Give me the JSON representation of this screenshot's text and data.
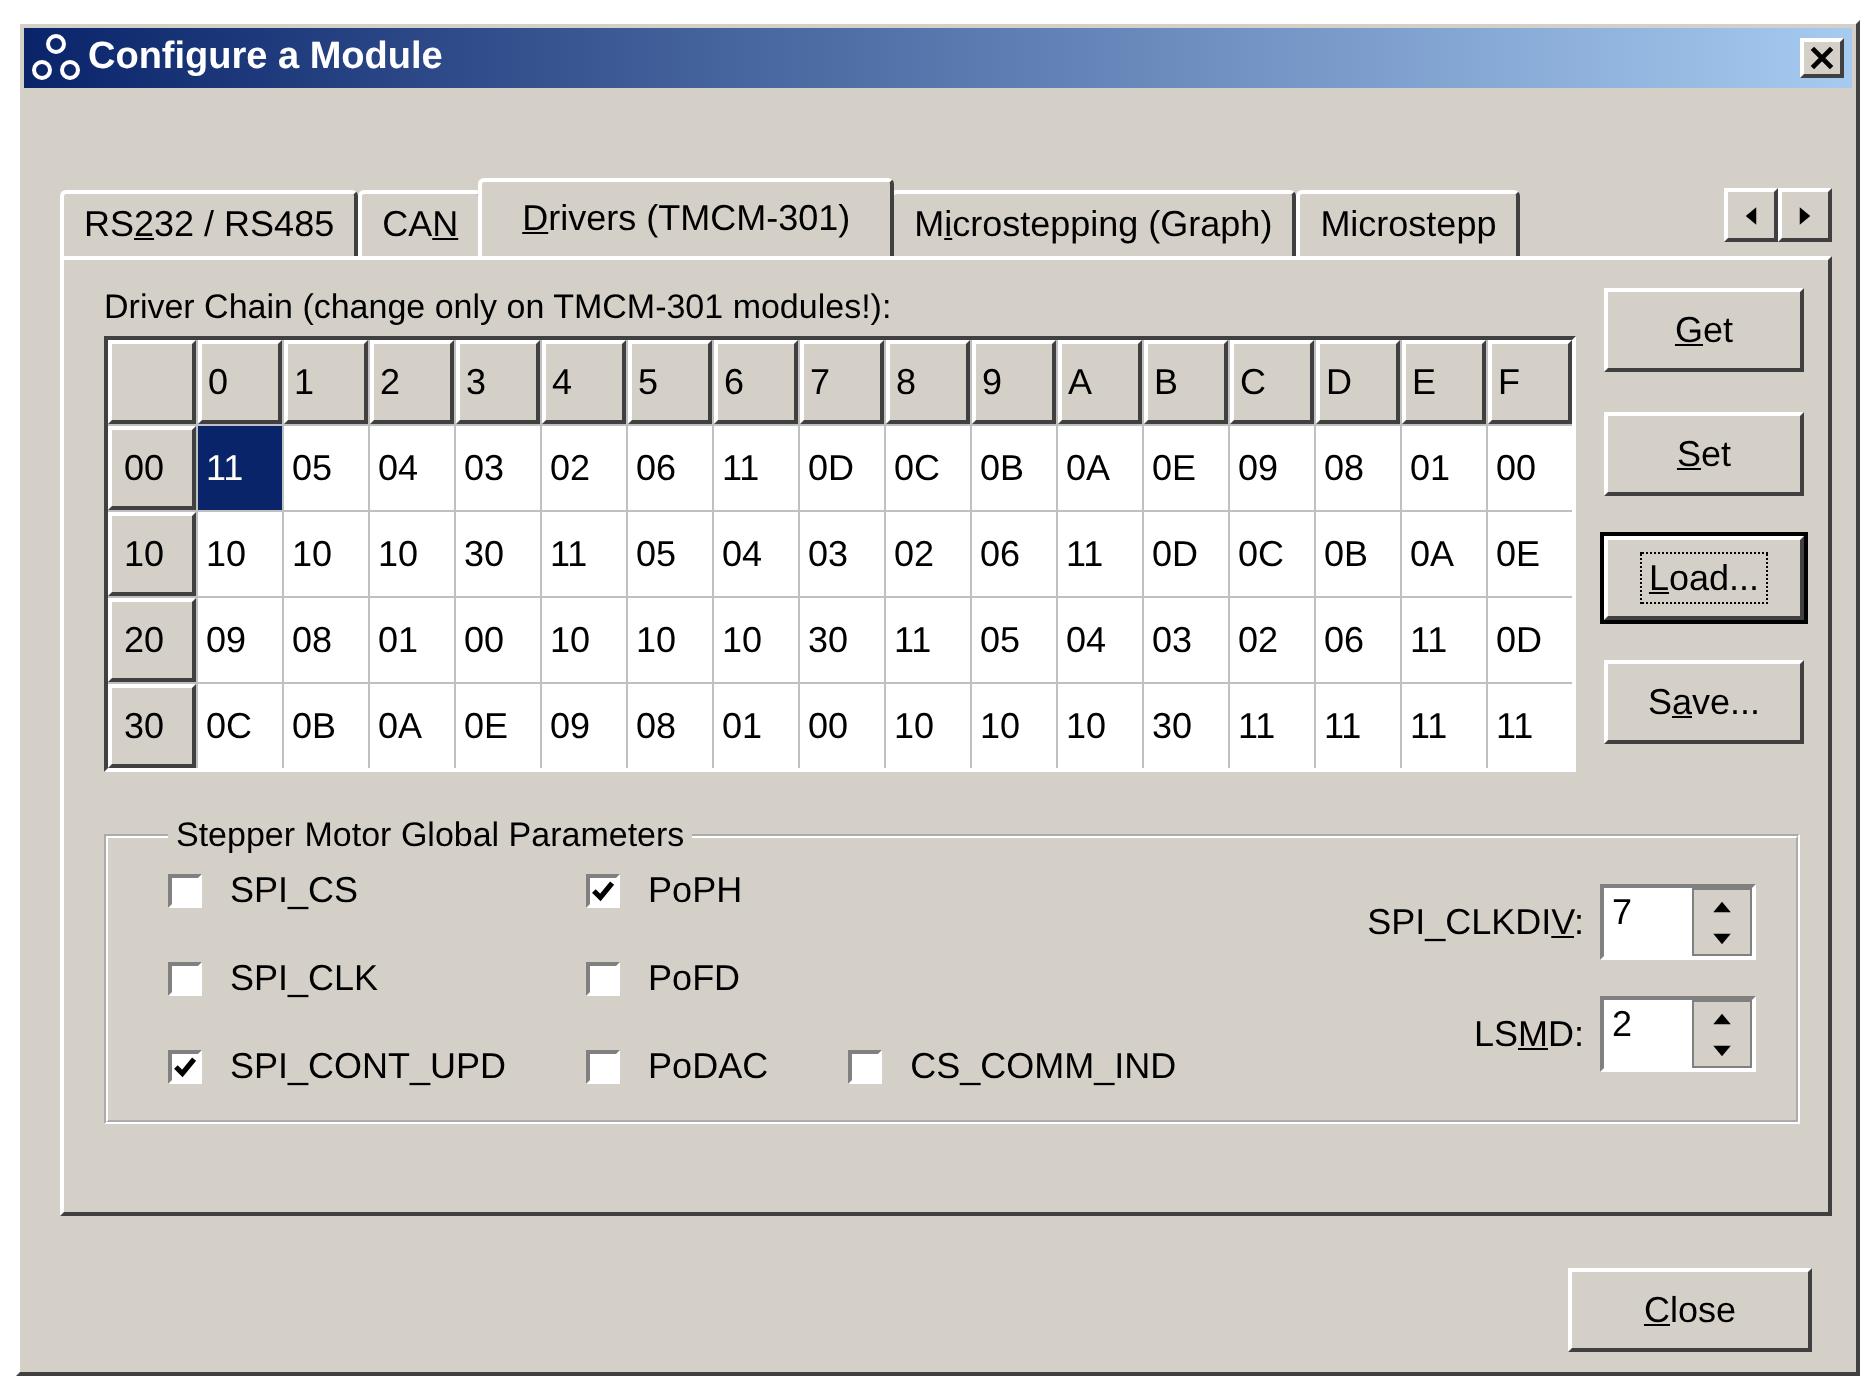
{
  "window": {
    "title": "Configure a Module"
  },
  "tabs": [
    {
      "label": {
        "pre": "RS",
        "u": "2",
        "post": "32 / RS485"
      },
      "selected": false
    },
    {
      "label": {
        "pre": "CA",
        "u": "N"
      },
      "selected": false
    },
    {
      "label": {
        "u": "D",
        "post": "rivers (TMCM-301)"
      },
      "selected": true
    },
    {
      "label": {
        "pre": "M",
        "u": "i",
        "post": "crostepping (Graph)"
      },
      "selected": false
    },
    {
      "label": {
        "pre": "Microstepp"
      },
      "selected": false
    }
  ],
  "driver_chain": {
    "caption": "Driver Chain (change only on TMCM-301 modules!):",
    "columns": [
      "0",
      "1",
      "2",
      "3",
      "4",
      "5",
      "6",
      "7",
      "8",
      "9",
      "A",
      "B",
      "C",
      "D",
      "E",
      "F"
    ],
    "rows": [
      {
        "header": "00",
        "cells": [
          {
            "value": "11",
            "selected": true
          },
          {
            "value": "05",
            "selected": false
          },
          {
            "value": "04",
            "selected": false
          },
          {
            "value": "03",
            "selected": false
          },
          {
            "value": "02",
            "selected": false
          },
          {
            "value": "06",
            "selected": false
          },
          {
            "value": "11",
            "selected": false
          },
          {
            "value": "0D",
            "selected": false
          },
          {
            "value": "0C",
            "selected": false
          },
          {
            "value": "0B",
            "selected": false
          },
          {
            "value": "0A",
            "selected": false
          },
          {
            "value": "0E",
            "selected": false
          },
          {
            "value": "09",
            "selected": false
          },
          {
            "value": "08",
            "selected": false
          },
          {
            "value": "01",
            "selected": false
          },
          {
            "value": "00",
            "selected": false
          }
        ]
      },
      {
        "header": "10",
        "cells": [
          {
            "value": "10",
            "selected": false
          },
          {
            "value": "10",
            "selected": false
          },
          {
            "value": "10",
            "selected": false
          },
          {
            "value": "30",
            "selected": false
          },
          {
            "value": "11",
            "selected": false
          },
          {
            "value": "05",
            "selected": false
          },
          {
            "value": "04",
            "selected": false
          },
          {
            "value": "03",
            "selected": false
          },
          {
            "value": "02",
            "selected": false
          },
          {
            "value": "06",
            "selected": false
          },
          {
            "value": "11",
            "selected": false
          },
          {
            "value": "0D",
            "selected": false
          },
          {
            "value": "0C",
            "selected": false
          },
          {
            "value": "0B",
            "selected": false
          },
          {
            "value": "0A",
            "selected": false
          },
          {
            "value": "0E",
            "selected": false
          }
        ]
      },
      {
        "header": "20",
        "cells": [
          {
            "value": "09",
            "selected": false
          },
          {
            "value": "08",
            "selected": false
          },
          {
            "value": "01",
            "selected": false
          },
          {
            "value": "00",
            "selected": false
          },
          {
            "value": "10",
            "selected": false
          },
          {
            "value": "10",
            "selected": false
          },
          {
            "value": "10",
            "selected": false
          },
          {
            "value": "30",
            "selected": false
          },
          {
            "value": "11",
            "selected": false
          },
          {
            "value": "05",
            "selected": false
          },
          {
            "value": "04",
            "selected": false
          },
          {
            "value": "03",
            "selected": false
          },
          {
            "value": "02",
            "selected": false
          },
          {
            "value": "06",
            "selected": false
          },
          {
            "value": "11",
            "selected": false
          },
          {
            "value": "0D",
            "selected": false
          }
        ]
      },
      {
        "header": "30",
        "cells": [
          {
            "value": "0C",
            "selected": false
          },
          {
            "value": "0B",
            "selected": false
          },
          {
            "value": "0A",
            "selected": false
          },
          {
            "value": "0E",
            "selected": false
          },
          {
            "value": "09",
            "selected": false
          },
          {
            "value": "08",
            "selected": false
          },
          {
            "value": "01",
            "selected": false
          },
          {
            "value": "00",
            "selected": false
          },
          {
            "value": "10",
            "selected": false
          },
          {
            "value": "10",
            "selected": false
          },
          {
            "value": "10",
            "selected": false
          },
          {
            "value": "30",
            "selected": false
          },
          {
            "value": "11",
            "selected": false
          },
          {
            "value": "11",
            "selected": false
          },
          {
            "value": "11",
            "selected": false
          },
          {
            "value": "11",
            "selected": false
          }
        ]
      }
    ]
  },
  "side_buttons": [
    {
      "label": {
        "u": "G",
        "post": "et"
      },
      "focused": false
    },
    {
      "label": {
        "u": "S",
        "post": "et"
      },
      "focused": false
    },
    {
      "label": {
        "u": "L",
        "post": "oad..."
      },
      "focused": true
    },
    {
      "label": {
        "pre": "S",
        "u": "a",
        "post": "ve..."
      },
      "focused": false
    }
  ],
  "parameters": {
    "title": "Stepper Motor Global Parameters",
    "checkbox_columns": [
      [
        {
          "label": "SPI_CS",
          "checked": false
        },
        {
          "label": "SPI_CLK",
          "checked": false
        },
        {
          "label": "SPI_CONT_UPD",
          "checked": true
        }
      ],
      [
        {
          "label": "PoPH",
          "checked": true
        },
        {
          "label": "PoFD",
          "checked": false
        },
        {
          "label": "PoDAC",
          "checked": false
        }
      ],
      [
        {
          "label": "CS_COMM_IND",
          "checked": false
        }
      ]
    ],
    "spinners": [
      {
        "label": {
          "pre": "SPI_CLKDI",
          "u": "V",
          "post": ":"
        },
        "value": "7"
      },
      {
        "label": {
          "pre": "LS",
          "u": "M",
          "post": "D:"
        },
        "value": "2"
      }
    ]
  },
  "footer_buttons": [
    {
      "label": {
        "u": "C",
        "post": "lose"
      },
      "focused": false
    }
  ]
}
